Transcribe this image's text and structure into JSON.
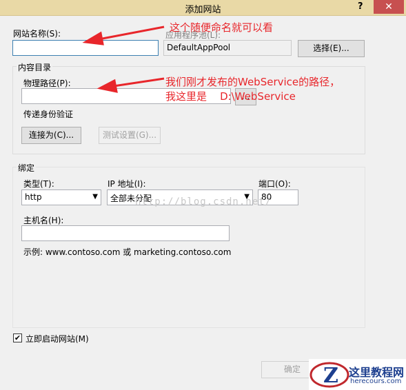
{
  "window": {
    "title": "添加网站",
    "help_label": "?",
    "close_label": "✕"
  },
  "site_name": {
    "label": "网站名称(S):",
    "value": ""
  },
  "app_pool": {
    "label": "应用程序池(L):",
    "value": "DefaultAppPool",
    "select_label": "选择(E)..."
  },
  "content_dir": {
    "group_label": "内容目录",
    "physical_path_label": "物理路径(P):",
    "physical_path_value": "",
    "browse_label": "...",
    "pass_auth_label": "传递身份验证",
    "connect_as_label": "连接为(C)...",
    "test_settings_label": "测试设置(G)..."
  },
  "binding": {
    "group_label": "绑定",
    "type_label": "类型(T):",
    "type_value": "http",
    "ip_label": "IP 地址(I):",
    "ip_value": "全部未分配",
    "port_label": "端口(O):",
    "port_value": "80",
    "hostname_label": "主机名(H):",
    "hostname_value": "",
    "example": "示例: www.contoso.com 或 marketing.contoso.com"
  },
  "start_immediately": {
    "label": "立即启动网站(M)",
    "checked": true,
    "check_glyph": "✔"
  },
  "footer": {
    "ok_label": "确定"
  },
  "annotations": {
    "a1": "这个随便命名就可以看",
    "a2_line1": "我们刚才发布的WebService的路径，",
    "a2_line2": "我这里是    D:\\WebService",
    "color": "#e8262b"
  },
  "watermark": {
    "text": "http://blog.csdn.net/"
  },
  "logo": {
    "main": "这里教程网",
    "sub": "herecours.com",
    "letter": "Z"
  }
}
